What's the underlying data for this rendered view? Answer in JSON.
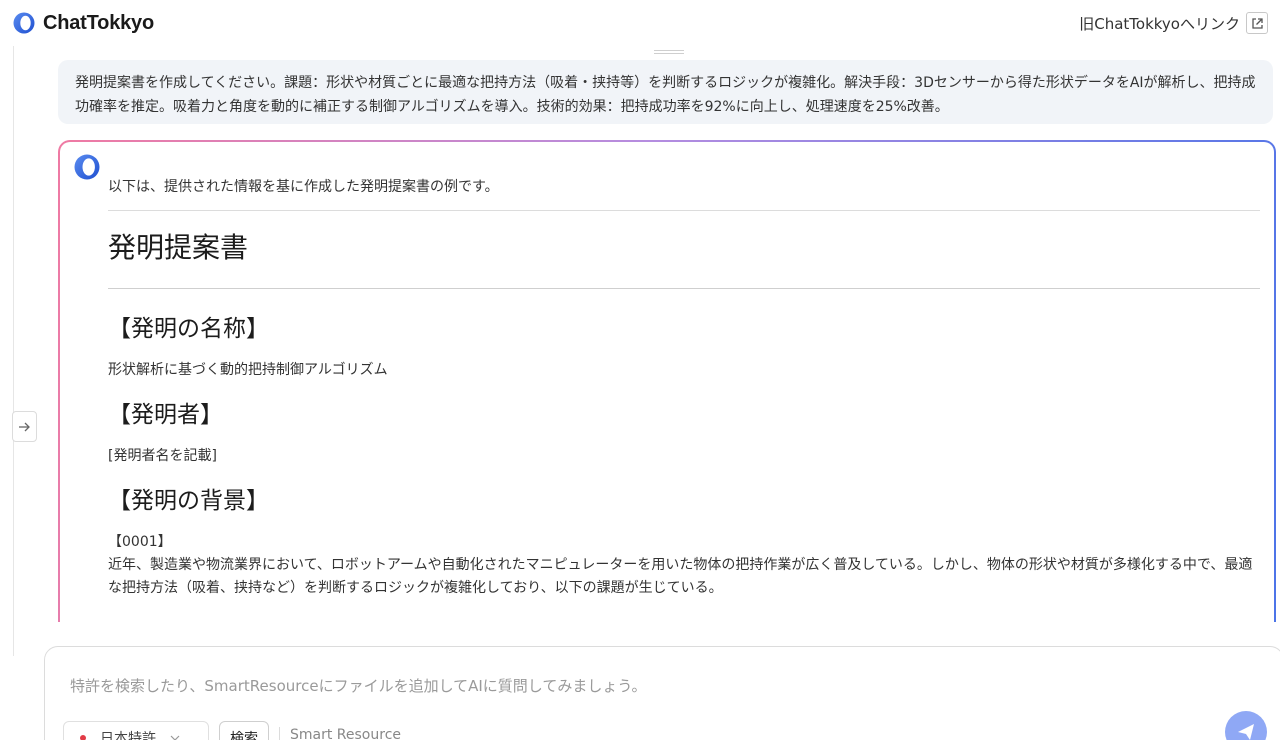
{
  "header": {
    "brand": "ChatTokkyo",
    "old_link": "旧ChatTokkyoへリンク"
  },
  "conversation": {
    "user_message": "発明提案書を作成してください。課題：形状や材質ごとに最適な把持方法（吸着・挟持等）を判断するロジックが複雑化。解決手段：3Dセンサーから得た形状データをAIが解析し、把持成功確率を推定。吸着力と角度を動的に補正する制御アルゴリズムを導入。技術的効果：把持成功率を92%に向上し、処理速度を25%改善。",
    "ai_reply": {
      "intro": "以下は、提供された情報を基に作成した発明提案書の例です。",
      "doc_title": "発明提案書",
      "sections": [
        {
          "heading": "【発明の名称】",
          "body": "形状解析に基づく動的把持制御アルゴリズム"
        },
        {
          "heading": "【発明者】",
          "body": "[発明者名を記載]"
        },
        {
          "heading": "【発明の背景】",
          "para_num": "【0001】",
          "body": "近年、製造業や物流業界において、ロボットアームや自動化されたマニピュレーターを用いた物体の把持作業が広く普及している。しかし、物体の形状や材質が多様化する中で、最適な把持方法（吸着、挟持など）を判断するロジックが複雑化しており、以下の課題が生じている。"
        }
      ]
    }
  },
  "composer": {
    "placeholder": "特許を検索したり、SmartResourceにファイルを追加してAIに質問してみましょう。",
    "db_select": "日本特許",
    "search_label": "検索",
    "smart_resource": "Smart Resource"
  },
  "colors": {
    "accent": "#2f6fe4",
    "user_bubble": "#f1f4f8",
    "send_button": "#8fa8f5"
  },
  "icons": {
    "logo": "chattokkyo-logo-icon",
    "external": "external-link-icon",
    "rail_toggle": "arrow-right-icon",
    "send": "paper-plane-icon",
    "flag": "japan-flag-icon",
    "dropdown": "chevron-down-icon"
  }
}
